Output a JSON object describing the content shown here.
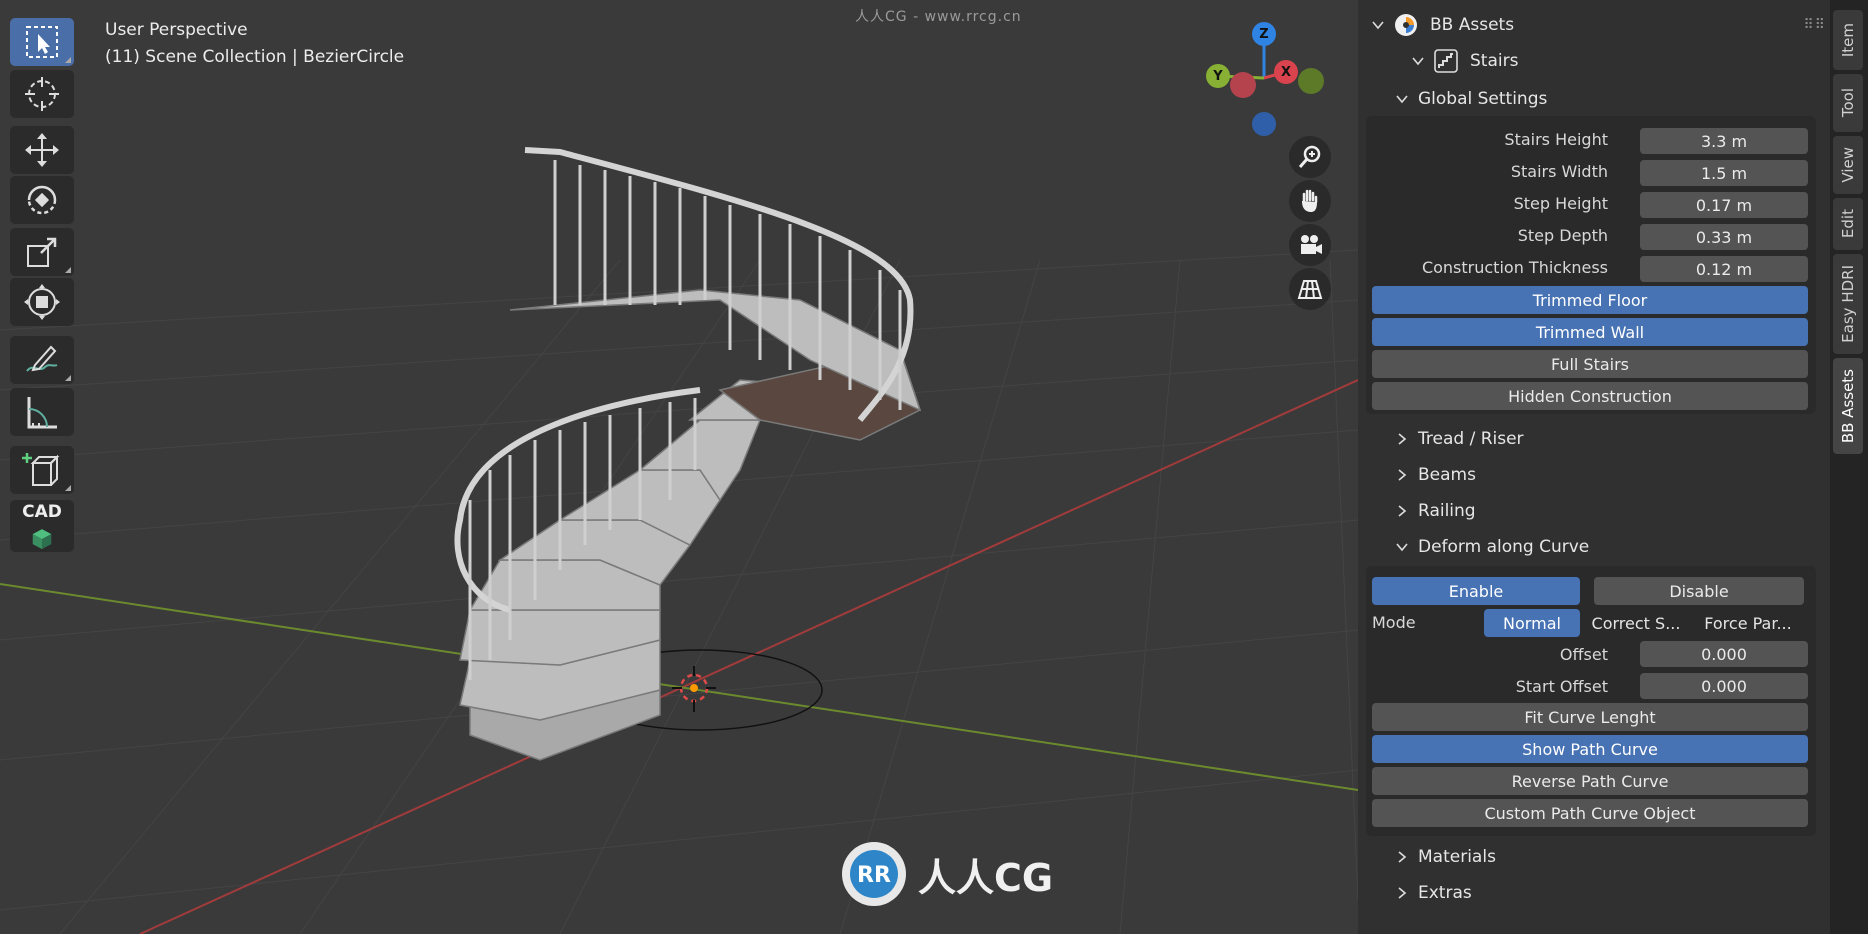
{
  "viewport": {
    "title": "User Perspective",
    "subtitle": "(11) Scene Collection | BezierCircle",
    "watermark_top": "人人CG - www.rrcg.cn",
    "watermark_logo": "人人CG"
  },
  "toolbar": {
    "cad_label": "CAD"
  },
  "gizmo": {
    "z": "Z",
    "y": "Y",
    "x": "X"
  },
  "panel": {
    "addon_title": "BB Assets",
    "stairs_title": "Stairs",
    "global_settings": {
      "title": "Global Settings",
      "stairs_height": {
        "label": "Stairs Height",
        "value": "3.3 m"
      },
      "stairs_width": {
        "label": "Stairs Width",
        "value": "1.5 m"
      },
      "step_height": {
        "label": "Step Height",
        "value": "0.17 m"
      },
      "step_depth": {
        "label": "Step Depth",
        "value": "0.33 m"
      },
      "construction_thickness": {
        "label": "Construction Thickness",
        "value": "0.12 m"
      },
      "trimmed_floor": "Trimmed Floor",
      "trimmed_wall": "Trimmed Wall",
      "full_stairs": "Full Stairs",
      "hidden_construction": "Hidden Construction"
    },
    "tread_riser": "Tread / Riser",
    "beams": "Beams",
    "railing": "Railing",
    "deform": {
      "title": "Deform along Curve",
      "enable": "Enable",
      "disable": "Disable",
      "mode_label": "Mode",
      "mode_normal": "Normal",
      "mode_correct": "Correct S...",
      "mode_force": "Force Par...",
      "offset": {
        "label": "Offset",
        "value": "0.000"
      },
      "start_offset": {
        "label": "Start Offset",
        "value": "0.000"
      },
      "fit_curve": "Fit Curve Lenght",
      "show_path": "Show Path Curve",
      "reverse_path": "Reverse Path Curve",
      "custom_path": "Custom Path Curve Object"
    },
    "materials": "Materials",
    "extras": "Extras"
  },
  "side_tabs": [
    "Item",
    "Tool",
    "View",
    "Edit",
    "Easy HDRI",
    "BB Assets"
  ],
  "colors": {
    "accent": "#4772b3",
    "x_axis": "#d9434d",
    "y_axis": "#87b034",
    "z_axis": "#2f84e3"
  }
}
